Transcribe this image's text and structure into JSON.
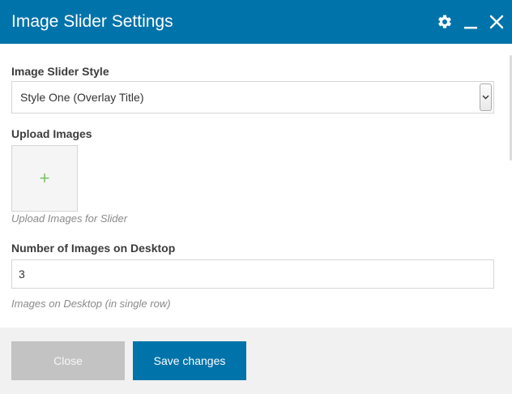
{
  "colors": {
    "header_bg": "#0073aa",
    "primary": "#0073aa",
    "accent_green": "#7ec16a"
  },
  "header": {
    "title": "Image Slider Settings",
    "icons": [
      "gear-icon",
      "minimize-icon",
      "close-icon"
    ]
  },
  "form": {
    "style": {
      "label": "Image Slider Style",
      "selected": "Style One (Overlay Title)"
    },
    "upload": {
      "label": "Upload Images",
      "add_symbol": "+",
      "hint": "Upload Images for Slider"
    },
    "desktop_count": {
      "label": "Number of Images on Desktop",
      "value": "3",
      "hint": "Images on Desktop (in single row)"
    }
  },
  "footer": {
    "close_label": "Close",
    "save_label": "Save changes"
  }
}
